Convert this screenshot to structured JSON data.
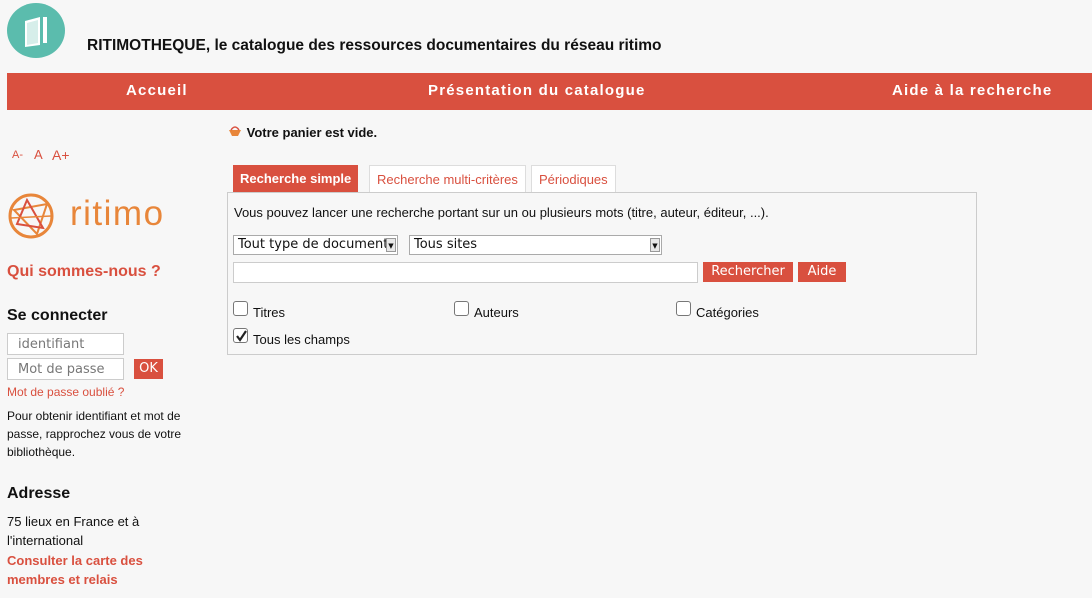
{
  "header": {
    "title": "RITIMOTHEQUE, le catalogue des ressources documentaires du réseau ritimo"
  },
  "nav": {
    "items": [
      "Accueil",
      "Présentation du catalogue",
      "Aide à la recherche"
    ]
  },
  "sidebar": {
    "font_sizes": [
      "A-",
      "A",
      "A+"
    ],
    "logo_text": "ritimo",
    "about_link": "Qui sommes-nous ?",
    "login": {
      "heading": "Se connecter",
      "username_placeholder": "identifiant",
      "password_placeholder": "Mot de passe",
      "ok_label": "OK",
      "forgot_link": "Mot de passe oublié ?",
      "help_text": "Pour obtenir identifiant et mot de passe, rapprochez vous de votre bibliothèque."
    },
    "address": {
      "heading": "Adresse",
      "text": "75 lieux en France et à l'international",
      "map_link": "Consulter la carte des membres et relais"
    }
  },
  "cart": {
    "status": "Votre panier est vide."
  },
  "search": {
    "tabs": [
      "Recherche simple",
      "Recherche multi-critères",
      "Périodiques"
    ],
    "active_tab": "Recherche simple",
    "intro": "Vous pouvez lancer une recherche portant sur un ou plusieurs mots (titre, auteur, éditeur, ...).",
    "doc_type_selected": "Tout type de document",
    "site_selected": "Tous sites",
    "query_value": "",
    "search_button": "Rechercher",
    "help_button": "Aide",
    "checkboxes": [
      {
        "label": "Titres",
        "checked": false
      },
      {
        "label": "Auteurs",
        "checked": false
      },
      {
        "label": "Catégories",
        "checked": false
      },
      {
        "label": "Tous les champs",
        "checked": true
      }
    ]
  },
  "colors": {
    "accent": "#d9503f",
    "logo_teal": "#5bbcad",
    "logo_orange": "#e8863a"
  }
}
